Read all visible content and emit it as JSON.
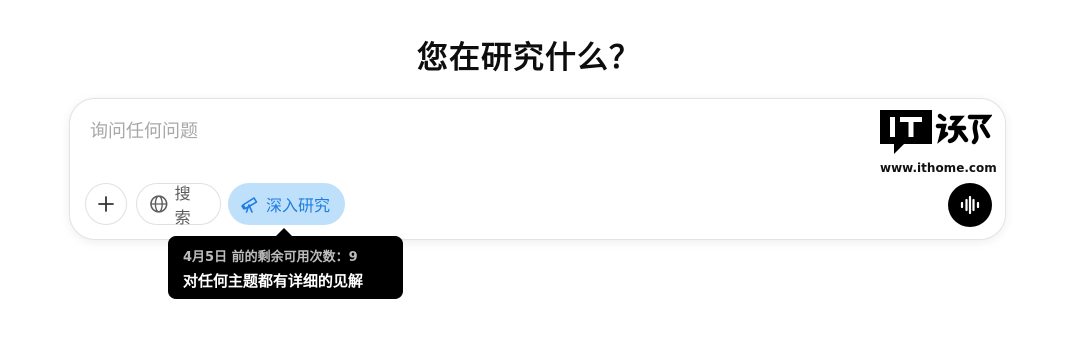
{
  "heading": "您在研究什么？",
  "composer": {
    "placeholder": "询问任何问题",
    "search_label": "搜索",
    "deep_research_label": "深入研究"
  },
  "tooltip": {
    "line1": "4月5日 前的剩余可用次数：9",
    "line2": "对任何主题都有详细的见解"
  },
  "watermark": {
    "logo_text": "IT之家",
    "url": "www.ithome.com"
  },
  "icons": {
    "add": "plus-icon",
    "search": "globe-icon",
    "deep_research": "telescope-icon",
    "voice": "voice-waveform-icon"
  },
  "colors": {
    "accent_blue": "#1f7de2",
    "research_pill_bg": "#bfe0fb",
    "tooltip_bg": "#000000"
  }
}
